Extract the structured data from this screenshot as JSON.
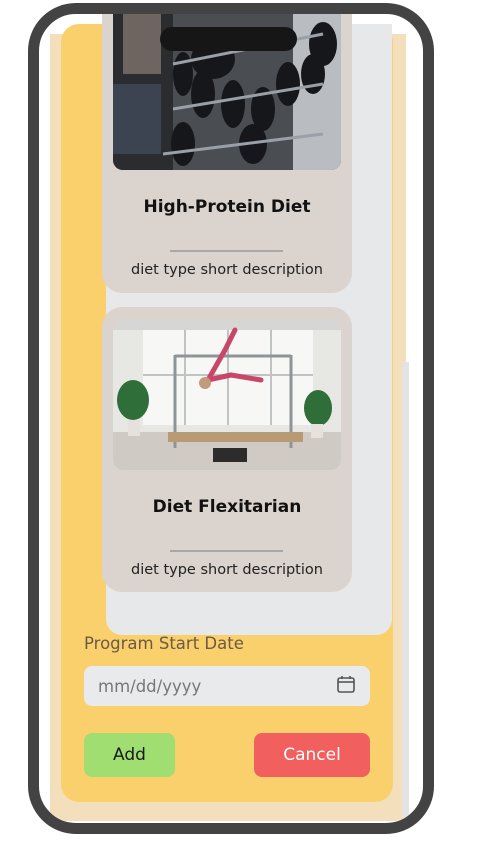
{
  "cards": [
    {
      "title": "High-Protein Diet",
      "description": "diet type short description",
      "image": "gym-dumbbell-rack-photo"
    },
    {
      "title": "Diet Flexitarian",
      "description": "diet type short description",
      "image": "pilates-reformer-photo"
    }
  ],
  "form": {
    "date_label": "Program Start Date",
    "date_placeholder": "mm/dd/yyyy"
  },
  "buttons": {
    "add": "Add",
    "cancel": "Cancel"
  },
  "colors": {
    "modal_bg": "#fad06d",
    "card_bg": "#dbd3cd",
    "add_button": "#a1de71",
    "cancel_button": "#f15f5f"
  },
  "icons": {
    "date": "calendar-icon"
  }
}
